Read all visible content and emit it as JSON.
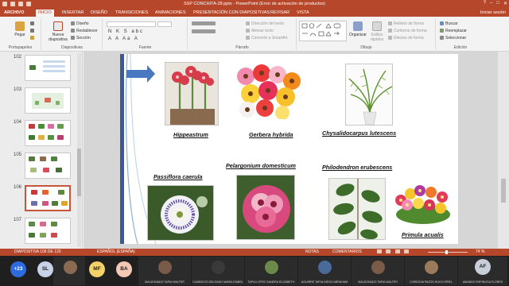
{
  "window": {
    "title": "SSP CONCHITA-28.pptx - PowerPoint (Error de activación de productos)",
    "controls": [
      "?",
      "–",
      "□",
      "✕"
    ]
  },
  "tabs": [
    "ARCHIVO",
    "INICIO",
    "INSERTAR",
    "DISEÑO",
    "TRANSICIONES",
    "ANIMACIONES",
    "PRESENTACIÓN CON DIAPOSITIVAS",
    "REVISAR",
    "VISTA"
  ],
  "active_tab": "INICIO",
  "signin": "Iniciar sesión",
  "ribbon": {
    "portapapeles": {
      "label": "Portapapeles",
      "paste": "Pegar"
    },
    "diapositivas": {
      "label": "Diapositivas",
      "new_slide": "Nueva diapositiva",
      "design": "Diseño",
      "reset": "Restablecer",
      "section": "Sección"
    },
    "fuente": {
      "label": "Fuente",
      "format_row1": "N K S abc",
      "format_row2": "A A Aa A"
    },
    "parrafo": {
      "label": "Párrafo",
      "text_direction": "Dirección del texto",
      "align_text": "Alinear texto",
      "convert_smartart": "Convertir a SmartArt"
    },
    "dibujo": {
      "label": "Dibujo",
      "arrange": "Organizar",
      "quick_styles": "Estilos rápidos",
      "shape_fill": "Relleno de forma",
      "shape_outline": "Contorno de forma",
      "shape_effects": "Efectos de forma"
    },
    "edicion": {
      "label": "Edición",
      "find": "Buscar",
      "replace": "Reemplazar",
      "select": "Seleccionar"
    }
  },
  "thumbnails": [
    {
      "num": "102",
      "selected": false
    },
    {
      "num": "103",
      "selected": false
    },
    {
      "num": "104",
      "selected": false
    },
    {
      "num": "105",
      "selected": false
    },
    {
      "num": "106",
      "selected": true
    },
    {
      "num": "107",
      "selected": false
    }
  ],
  "slide": {
    "captions": [
      "Hippeastrum",
      "Gerbera hybrida",
      "Chysalidocarpus lutescens",
      "Passiflora caerula",
      "Pelargonium domesticum",
      "Philodendron erubescens",
      "Primula acualis"
    ]
  },
  "statusbar": {
    "slide_counter": "DIAPOSITIVA 106 DE 120",
    "language": "ESPAÑOL (ESPAÑA)",
    "notes": "NOTAS",
    "comments": "COMENTARIOS",
    "zoom": "74 %"
  },
  "meeting": {
    "overflow": "+23",
    "initials": [
      "SL",
      "MF",
      "BA",
      "AF"
    ],
    "participants": [
      "MALDONADO TAPIA WALTER",
      "CUMBICOS DELGADO MARIA ISABEL",
      "TAPIA LOPEZ SANDRA ELIZABETH",
      "AGUIRRE TAPIA DIEGO ABRAHAM",
      "MALDONADO TAPIA WALTER",
      "CORDOVA PAZOS HUGO ERIEL",
      "AMANDO ESPINOSA FLORES"
    ]
  },
  "colors": {
    "accent": "#b7472a",
    "slide_bar": "#3a5a9a"
  }
}
